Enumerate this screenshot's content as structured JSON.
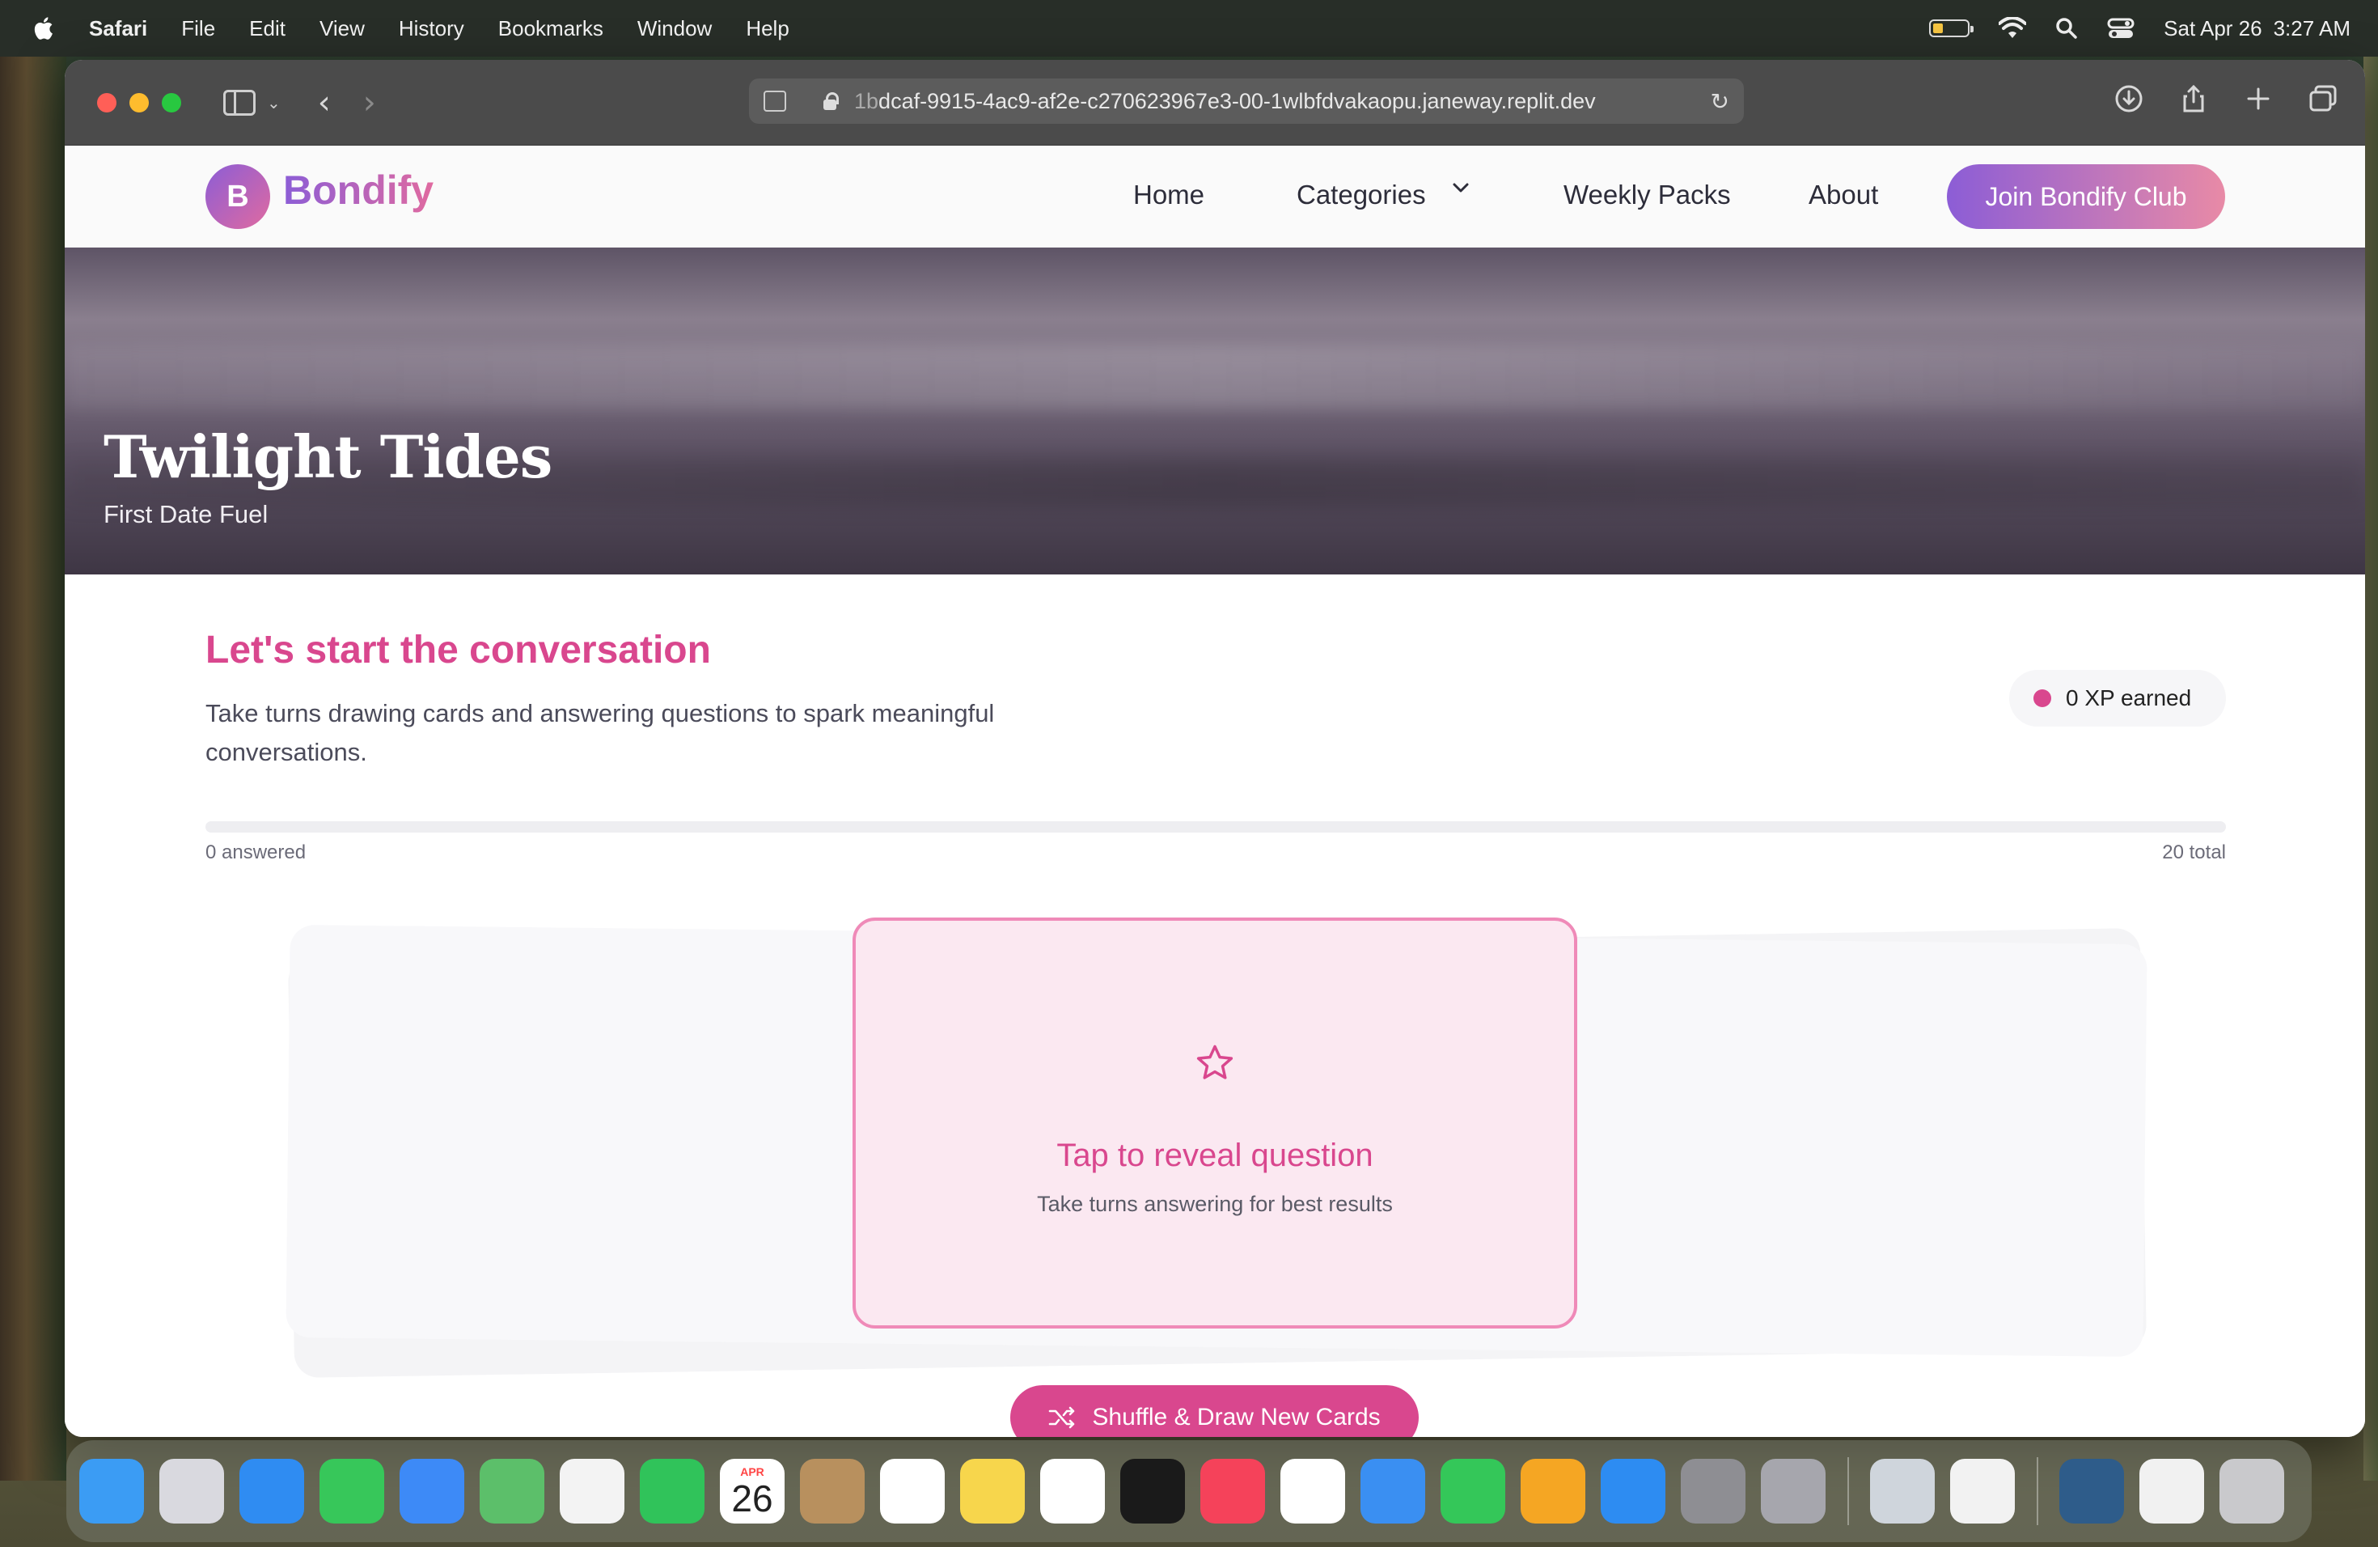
{
  "menubar": {
    "app": "Safari",
    "items": [
      "File",
      "Edit",
      "View",
      "History",
      "Bookmarks",
      "Window",
      "Help"
    ],
    "date": "Sat Apr 26",
    "time": "3:27 AM"
  },
  "browser": {
    "url_prefix": "1b",
    "url": "dcaf-9915-4ac9-af2e-c270623967e3-00-1wlbfdvakaopu.janeway.replit.dev"
  },
  "site": {
    "logo_letter": "B",
    "logo_text": "Bondify",
    "nav": {
      "home": "Home",
      "categories": "Categories",
      "weekly": "Weekly Packs",
      "about": "About",
      "join": "Join Bondify Club"
    }
  },
  "hero": {
    "title": "Twilight Tides",
    "subtitle": "First Date Fuel"
  },
  "session": {
    "title": "Let's start the conversation",
    "description": "Take turns drawing cards and answering questions to spark meaningful conversations.",
    "xp_label": "0 XP earned",
    "answered_label": "0 answered",
    "total_label": "20 total",
    "progress_fraction": 0
  },
  "card": {
    "prompt": "Tap to reveal question",
    "hint": "Take turns answering for best results"
  },
  "shuffle_button": "Shuffle & Draw New Cards",
  "dock": {
    "calendar_month": "APR",
    "calendar_day": "26",
    "apps": [
      {
        "name": "finder",
        "color": "#3b9cf4"
      },
      {
        "name": "launchpad",
        "color": "#d9d9df"
      },
      {
        "name": "safari",
        "color": "#2f8cf2"
      },
      {
        "name": "messages",
        "color": "#37c75a"
      },
      {
        "name": "mail",
        "color": "#3d8af7"
      },
      {
        "name": "maps",
        "color": "#5cbf6a"
      },
      {
        "name": "photos",
        "color": "#f3f3f3"
      },
      {
        "name": "facetime",
        "color": "#30c35a"
      },
      {
        "name": "calendar",
        "color": "#ffffff"
      },
      {
        "name": "contacts",
        "color": "#b8905e"
      },
      {
        "name": "reminders",
        "color": "#ffffff"
      },
      {
        "name": "notes",
        "color": "#f7d64c"
      },
      {
        "name": "freeform",
        "color": "#ffffff"
      },
      {
        "name": "tv",
        "color": "#1a1a1a"
      },
      {
        "name": "music",
        "color": "#f5425a"
      },
      {
        "name": "news",
        "color": "#ffffff"
      },
      {
        "name": "keynote",
        "color": "#3a8ff2"
      },
      {
        "name": "numbers",
        "color": "#34c759"
      },
      {
        "name": "pages",
        "color": "#f5a623"
      },
      {
        "name": "app-store",
        "color": "#2d8cf2"
      },
      {
        "name": "system-settings",
        "color": "#8e8e93"
      },
      {
        "name": "iphone-mirroring",
        "color": "#a6a6ad"
      }
    ],
    "recent": [
      {
        "name": "preview",
        "color": "#cfd5dc"
      },
      {
        "name": "passwords",
        "color": "#f2f2f2"
      }
    ],
    "stacks": [
      {
        "name": "screenshots-stack",
        "color": "#2e5c8a"
      },
      {
        "name": "documents-stack",
        "color": "#f1f1f1"
      },
      {
        "name": "trash",
        "color": "#c9c9cc"
      }
    ]
  }
}
